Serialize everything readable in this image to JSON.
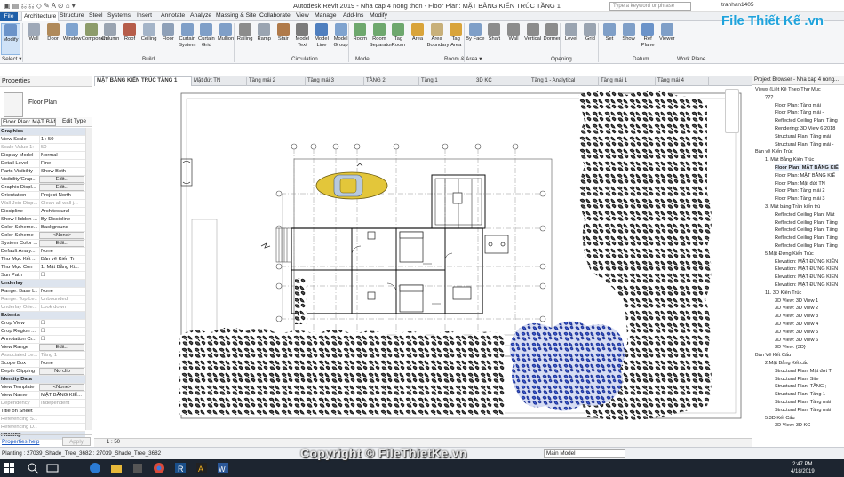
{
  "app": {
    "title": "Autodesk Revit 2019 - Nha cap 4 nong thon - Floor Plan: MẶT BẰNG KIẾN TRÚC TẦNG 1",
    "search_placeholder": "Type a keyword or phrase",
    "user": "tranhan1405",
    "accent": "#1f5fa8"
  },
  "ribbon_tabs": [
    "File",
    "Architecture",
    "Structure",
    "Steel",
    "Systems",
    "Insert",
    "Annotate",
    "Analyze",
    "Massing & Site",
    "Collaborate",
    "View",
    "Manage",
    "Add-Ins",
    "Modify"
  ],
  "ribbon": {
    "tools": [
      "Modify",
      "Wall",
      "Door",
      "Window",
      "Component",
      "Column",
      "Roof",
      "Ceiling",
      "Floor",
      "Curtain System",
      "Curtain Grid",
      "Mullion",
      "Railing",
      "Ramp",
      "Stair",
      "Model Text",
      "Model Line",
      "Model Group",
      "Room",
      "Room Separator",
      "Tag Room",
      "Area",
      "Area Boundary",
      "Tag Area",
      "By Face",
      "Shaft",
      "Wall",
      "Vertical",
      "Dormer",
      "Level",
      "Grid",
      "Set",
      "Show",
      "Ref Plane",
      "Viewer"
    ],
    "panels": [
      "Select ▾",
      "Build",
      "Circulation",
      "Model",
      "Room & Area ▾",
      "Opening",
      "Datum",
      "Work Plane"
    ]
  },
  "properties": {
    "title": "Properties",
    "type_name": "Floor Plan",
    "selector": "Floor Plan: MẶT BẰN",
    "edit_type": "Edit Type",
    "rows": [
      {
        "k": "Graphics",
        "v": "",
        "group": true
      },
      {
        "k": "View Scale",
        "v": "1 : 50"
      },
      {
        "k": "Scale Value 1:",
        "v": "50",
        "gray": true
      },
      {
        "k": "Display Model",
        "v": "Normal"
      },
      {
        "k": "Detail Level",
        "v": "Fine"
      },
      {
        "k": "Parts Visibility",
        "v": "Show Both"
      },
      {
        "k": "Visibility/Grap...",
        "v": "Edit...",
        "btn": true
      },
      {
        "k": "Graphic Displ...",
        "v": "Edit...",
        "btn": true
      },
      {
        "k": "Orientation",
        "v": "Project North"
      },
      {
        "k": "Wall Join Disp...",
        "v": "Clean all wall j...",
        "gray": true
      },
      {
        "k": "Discipline",
        "v": "Architectural"
      },
      {
        "k": "Show Hidden ...",
        "v": "By Discipline"
      },
      {
        "k": "Color Scheme...",
        "v": "Background"
      },
      {
        "k": "Color Scheme",
        "v": "<None>",
        "btn": true
      },
      {
        "k": "System Color ...",
        "v": "Edit...",
        "btn": true
      },
      {
        "k": "Default Analy...",
        "v": "None"
      },
      {
        "k": "Thư Mục Kết ...",
        "v": "Bản vẽ Kiến Tr"
      },
      {
        "k": "Thư Mục Con",
        "v": "1. Mặt Bằng Ki..."
      },
      {
        "k": "Sun Path",
        "v": "☐"
      },
      {
        "k": "Underlay",
        "v": "",
        "group": true
      },
      {
        "k": "Range: Base L...",
        "v": "None"
      },
      {
        "k": "Range: Top Le...",
        "v": "Unbounded",
        "gray": true
      },
      {
        "k": "Underlay Orie...",
        "v": "Look down",
        "gray": true
      },
      {
        "k": "Extents",
        "v": "",
        "group": true
      },
      {
        "k": "Crop View",
        "v": "☐"
      },
      {
        "k": "Crop Region ...",
        "v": "☐"
      },
      {
        "k": "Annotation Cr...",
        "v": "☐"
      },
      {
        "k": "View Range",
        "v": "Edit...",
        "btn": true
      },
      {
        "k": "Associated Le...",
        "v": "Tầng 1",
        "gray": true
      },
      {
        "k": "Scope Box",
        "v": "None"
      },
      {
        "k": "Depth Clipping",
        "v": "No clip",
        "btn": true
      },
      {
        "k": "Identity Data",
        "v": "",
        "group": true
      },
      {
        "k": "View Template",
        "v": "<None>",
        "btn": true
      },
      {
        "k": "View Name",
        "v": "MẶT BẰNG KIẾ..."
      },
      {
        "k": "Dependency",
        "v": "Independent",
        "gray": true
      },
      {
        "k": "Title on Sheet",
        "v": ""
      },
      {
        "k": "Referencing S...",
        "v": "",
        "gray": true
      },
      {
        "k": "Referencing D...",
        "v": "",
        "gray": true
      },
      {
        "k": "Phasing",
        "v": "",
        "group": true
      }
    ],
    "help": "Properties help",
    "apply": "Apply"
  },
  "view_tabs": [
    "MẶT BẰNG KIẾN TRÚC TẦNG 1",
    "Mặt đứt TN",
    "Tầng mái 2",
    "Tầng mái 3",
    "TẦNG 2",
    "Tầng 1",
    "3D KC",
    "Tầng 1 - Analytical",
    "Tầng mái 1",
    "Tầng mái 4"
  ],
  "view": {
    "scale": "1 : 50",
    "tree_dark": "#1c1c1c",
    "tree_blue": "#2a49b0",
    "car_color": "#e3c63a"
  },
  "browser": {
    "title": "Project Browser - Nha cap 4 nong...",
    "items": [
      {
        "t": "Views (Liệt Kê Theo Thư Mục",
        "d": 0
      },
      {
        "t": "???",
        "d": 1
      },
      {
        "t": "Floor Plan: Tầng mái",
        "d": 2
      },
      {
        "t": "Floor Plan: Tầng mái -",
        "d": 2
      },
      {
        "t": "Reflected Ceiling Plan: Tầng",
        "d": 2
      },
      {
        "t": "Rendering: 3D View 6 2018",
        "d": 2
      },
      {
        "t": "Structural Plan: Tầng mái",
        "d": 2
      },
      {
        "t": "Structural Plan: Tầng mái -",
        "d": 2
      },
      {
        "t": "Bản vẽ Kiến Trúc",
        "d": 0
      },
      {
        "t": "1. Mặt Bằng Kiến Trúc",
        "d": 1
      },
      {
        "t": "Floor Plan: MẶT BẰNG KIẾ",
        "d": 2,
        "bold": true
      },
      {
        "t": "Floor Plan: MẶT BẰNG KIẾ",
        "d": 2
      },
      {
        "t": "Floor Plan: Mặt đứt TN",
        "d": 2
      },
      {
        "t": "Floor Plan: Tầng mái 2",
        "d": 2
      },
      {
        "t": "Floor Plan: Tầng mái 3",
        "d": 2
      },
      {
        "t": "3. Mặt bằng Trần kiến trú",
        "d": 1
      },
      {
        "t": "Reflected Ceiling Plan: Mặt",
        "d": 2
      },
      {
        "t": "Reflected Ceiling Plan: Tầng",
        "d": 2
      },
      {
        "t": "Reflected Ceiling Plan: Tầng",
        "d": 2
      },
      {
        "t": "Reflected Ceiling Plan: Tầng",
        "d": 2
      },
      {
        "t": "Reflected Ceiling Plan: Tầng",
        "d": 2
      },
      {
        "t": "5.Mặt Đứng Kiến Trúc",
        "d": 1
      },
      {
        "t": "Elevation: MẶT ĐỨNG KIẾN",
        "d": 2
      },
      {
        "t": "Elevation: MẶT ĐỨNG KIẾN",
        "d": 2
      },
      {
        "t": "Elevation: MẶT ĐỨNG KIẾN",
        "d": 2
      },
      {
        "t": "Elevation: MẶT ĐỨNG KIẾN",
        "d": 2
      },
      {
        "t": "11. 3D Kiến Trúc",
        "d": 1
      },
      {
        "t": "3D View: 3D View 1",
        "d": 2
      },
      {
        "t": "3D View: 3D View 2",
        "d": 2
      },
      {
        "t": "3D View: 3D View 3",
        "d": 2
      },
      {
        "t": "3D View: 3D View 4",
        "d": 2
      },
      {
        "t": "3D View: 3D View 5",
        "d": 2
      },
      {
        "t": "3D View: 3D View 6",
        "d": 2
      },
      {
        "t": "3D View: {3D}",
        "d": 2
      },
      {
        "t": "Bản Vẽ Kết Cấu",
        "d": 0
      },
      {
        "t": "2.Mặt Bằng Kết cấu",
        "d": 1
      },
      {
        "t": "Structural Plan: Mặt đứt T",
        "d": 2
      },
      {
        "t": "Structural Plan: Site",
        "d": 2
      },
      {
        "t": "Structural Plan: TẦNG ;",
        "d": 2
      },
      {
        "t": "Structural Plan: Tầng 1",
        "d": 2
      },
      {
        "t": "Structural Plan: Tầng mái",
        "d": 2
      },
      {
        "t": "Structural Plan: Tầng mái",
        "d": 2
      },
      {
        "t": "5.3D Kết Cấu",
        "d": 1
      },
      {
        "t": "3D View: 3D KC",
        "d": 2
      }
    ]
  },
  "status": {
    "text": "Planting : 27039_Shade_Tree_3682 : 27039_Shade_Tree_3682",
    "model": "Main Model"
  },
  "taskbar": {
    "time": "2:47 PM",
    "date": "4/18/2019"
  },
  "watermark": "Copyright © FileThietKe.vn",
  "logo": "File Thiết Kế .vn"
}
